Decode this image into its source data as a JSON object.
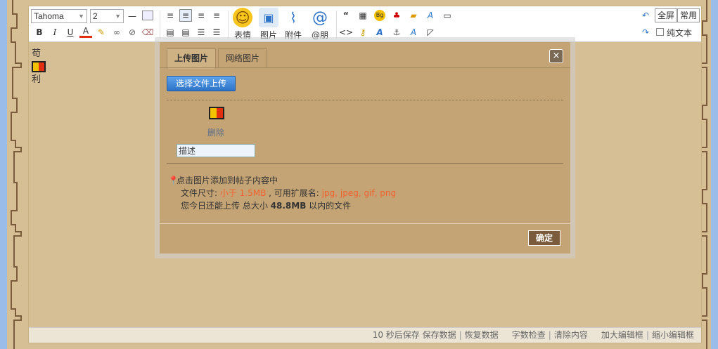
{
  "toolbar": {
    "font_family": "Tahoma",
    "font_size": "2",
    "big_buttons": [
      {
        "label": "表情",
        "icon": "smiley-icon"
      },
      {
        "label": "图片",
        "icon": "image-icon"
      },
      {
        "label": "附件",
        "icon": "paperclip-icon"
      },
      {
        "label": "@朋",
        "icon": "at-icon"
      }
    ],
    "format": {
      "bold": "B",
      "italic": "I",
      "underline": "U",
      "color": "A",
      "quote": "“",
      "bg": "Bg",
      "code": "<>",
      "font": "A",
      "sup": "A",
      "sub": "A"
    },
    "fullscreen_label": "全屏",
    "common_label": "常用",
    "plain_text_label": "纯文本"
  },
  "content": {
    "line1": "苟",
    "line2": "利"
  },
  "dialog": {
    "tabs": [
      {
        "label": "上传图片",
        "active": true
      },
      {
        "label": "网络图片",
        "active": false
      }
    ],
    "close_label": "×",
    "upload_button": "选择文件上传",
    "delete_link": "删除",
    "description_placeholder": "描述",
    "tips": {
      "line1": "点击图片添加到帖子内容中",
      "size_prefix": "文件尺寸: ",
      "size_value": "小于 1.5MB",
      "ext_prefix": " , 可用扩展名: ",
      "ext_value": "jpg, jpeg, gif, png",
      "quota_prefix": "您今日还能上传 总大小 ",
      "quota_value": "48.8MB",
      "quota_suffix": " 以内的文件"
    },
    "ok_button": "确定"
  },
  "statusbar": {
    "autosave": "10 秒后保存",
    "save": "保存数据",
    "restore": "恢复数据",
    "wordcheck": "字数检查",
    "clear": "清除内容",
    "enlarge": "加大编辑框",
    "shrink": "缩小编辑框"
  },
  "colors": {
    "page_bg": "#d6bf95",
    "dialog_bg": "#c4a475",
    "accent_blue": "#2d74c8",
    "ok_button": "#7a5c3c",
    "highlight_red": "#f0622e"
  }
}
